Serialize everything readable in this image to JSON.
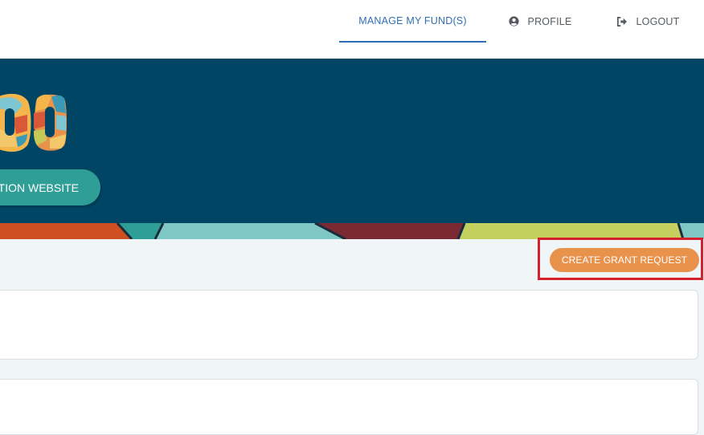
{
  "nav": {
    "items": [
      {
        "label": "MANAGE MY FUND(S)",
        "active": true
      },
      {
        "label": "PROFILE",
        "icon": "user-circle-icon"
      },
      {
        "label": "LOGOUT",
        "icon": "sign-out-icon"
      }
    ]
  },
  "hero": {
    "website_button_label": "TION WEBSITE",
    "logo_text": "00"
  },
  "actions": {
    "create_grant_label": "CREATE GRANT REQUEST"
  },
  "colors": {
    "nav_active": "#2f6fb5",
    "hero_bg": "#004563",
    "teal_button": "#2f9e96",
    "orange_button": "#e9924c",
    "highlight": "#d6202e"
  }
}
